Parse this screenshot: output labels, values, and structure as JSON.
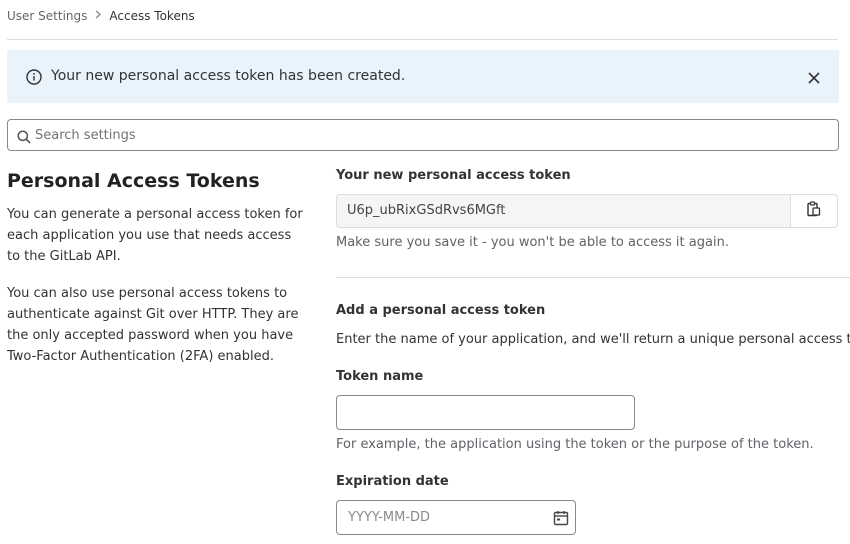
{
  "breadcrumb": {
    "parent": "User Settings",
    "current": "Access Tokens"
  },
  "alert": {
    "message": "Your new personal access token has been created.",
    "icon": "info-icon",
    "close_icon": "close-icon"
  },
  "search": {
    "placeholder": "Search settings",
    "value": ""
  },
  "intro": {
    "title": "Personal Access Tokens",
    "paragraph1": "You can generate a personal access token for each application you use that needs access to the GitLab API.",
    "paragraph2": "You can also use personal access tokens to authenticate against Git over HTTP. They are the only accepted password when you have Two-Factor Authentication (2FA) enabled."
  },
  "new_token": {
    "label": "Your new personal access token",
    "value": "U6p_ubRixGSdRvs6MGft",
    "help": "Make sure you save it - you won't be able to access it again.",
    "copy_icon": "clipboard-icon"
  },
  "add_token": {
    "title": "Add a personal access token",
    "description": "Enter the name of your application, and we'll return a unique personal access token.",
    "name_label": "Token name",
    "name_value": "",
    "name_help": "For example, the application using the token or the purpose of the token.",
    "expiration_label": "Expiration date",
    "expiration_placeholder": "YYYY-MM-DD",
    "calendar_icon": "calendar-icon"
  }
}
